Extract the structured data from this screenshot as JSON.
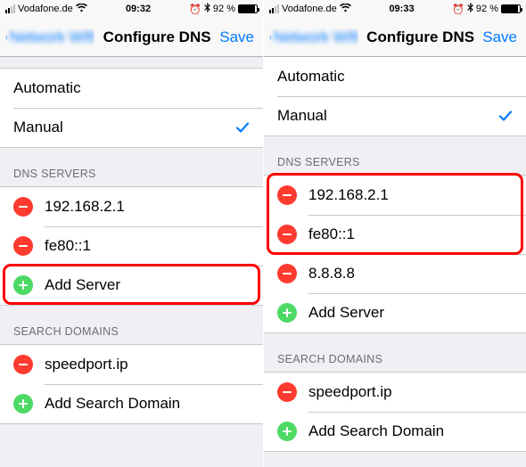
{
  "left": {
    "status": {
      "carrier": "Vodafone.de",
      "time": "09:32",
      "batteryText": "92 %"
    },
    "nav": {
      "back": "Network Wifi",
      "title": "Configure DNS",
      "save": "Save"
    },
    "modes": {
      "automatic": "Automatic",
      "manual": "Manual",
      "selected": "manual"
    },
    "dnsHeader": "DNS SERVERS",
    "dnsServers": [
      "192.168.2.1",
      "fe80::1"
    ],
    "addServer": "Add Server",
    "searchHeader": "SEARCH DOMAINS",
    "searchDomains": [
      "speedport.ip"
    ],
    "addSearch": "Add Search Domain"
  },
  "right": {
    "status": {
      "carrier": "Vodafone.de",
      "time": "09:33",
      "batteryText": "92 %"
    },
    "nav": {
      "back": "Network Wifi",
      "title": "Configure DNS",
      "save": "Save"
    },
    "modes": {
      "automatic": "Automatic",
      "manual": "Manual",
      "selected": "manual"
    },
    "dnsHeader": "DNS SERVERS",
    "dnsServers": [
      "192.168.2.1",
      "fe80::1",
      "8.8.8.8"
    ],
    "addServer": "Add Server",
    "searchHeader": "SEARCH DOMAINS",
    "searchDomains": [
      "speedport.ip"
    ],
    "addSearch": "Add Search Domain"
  }
}
